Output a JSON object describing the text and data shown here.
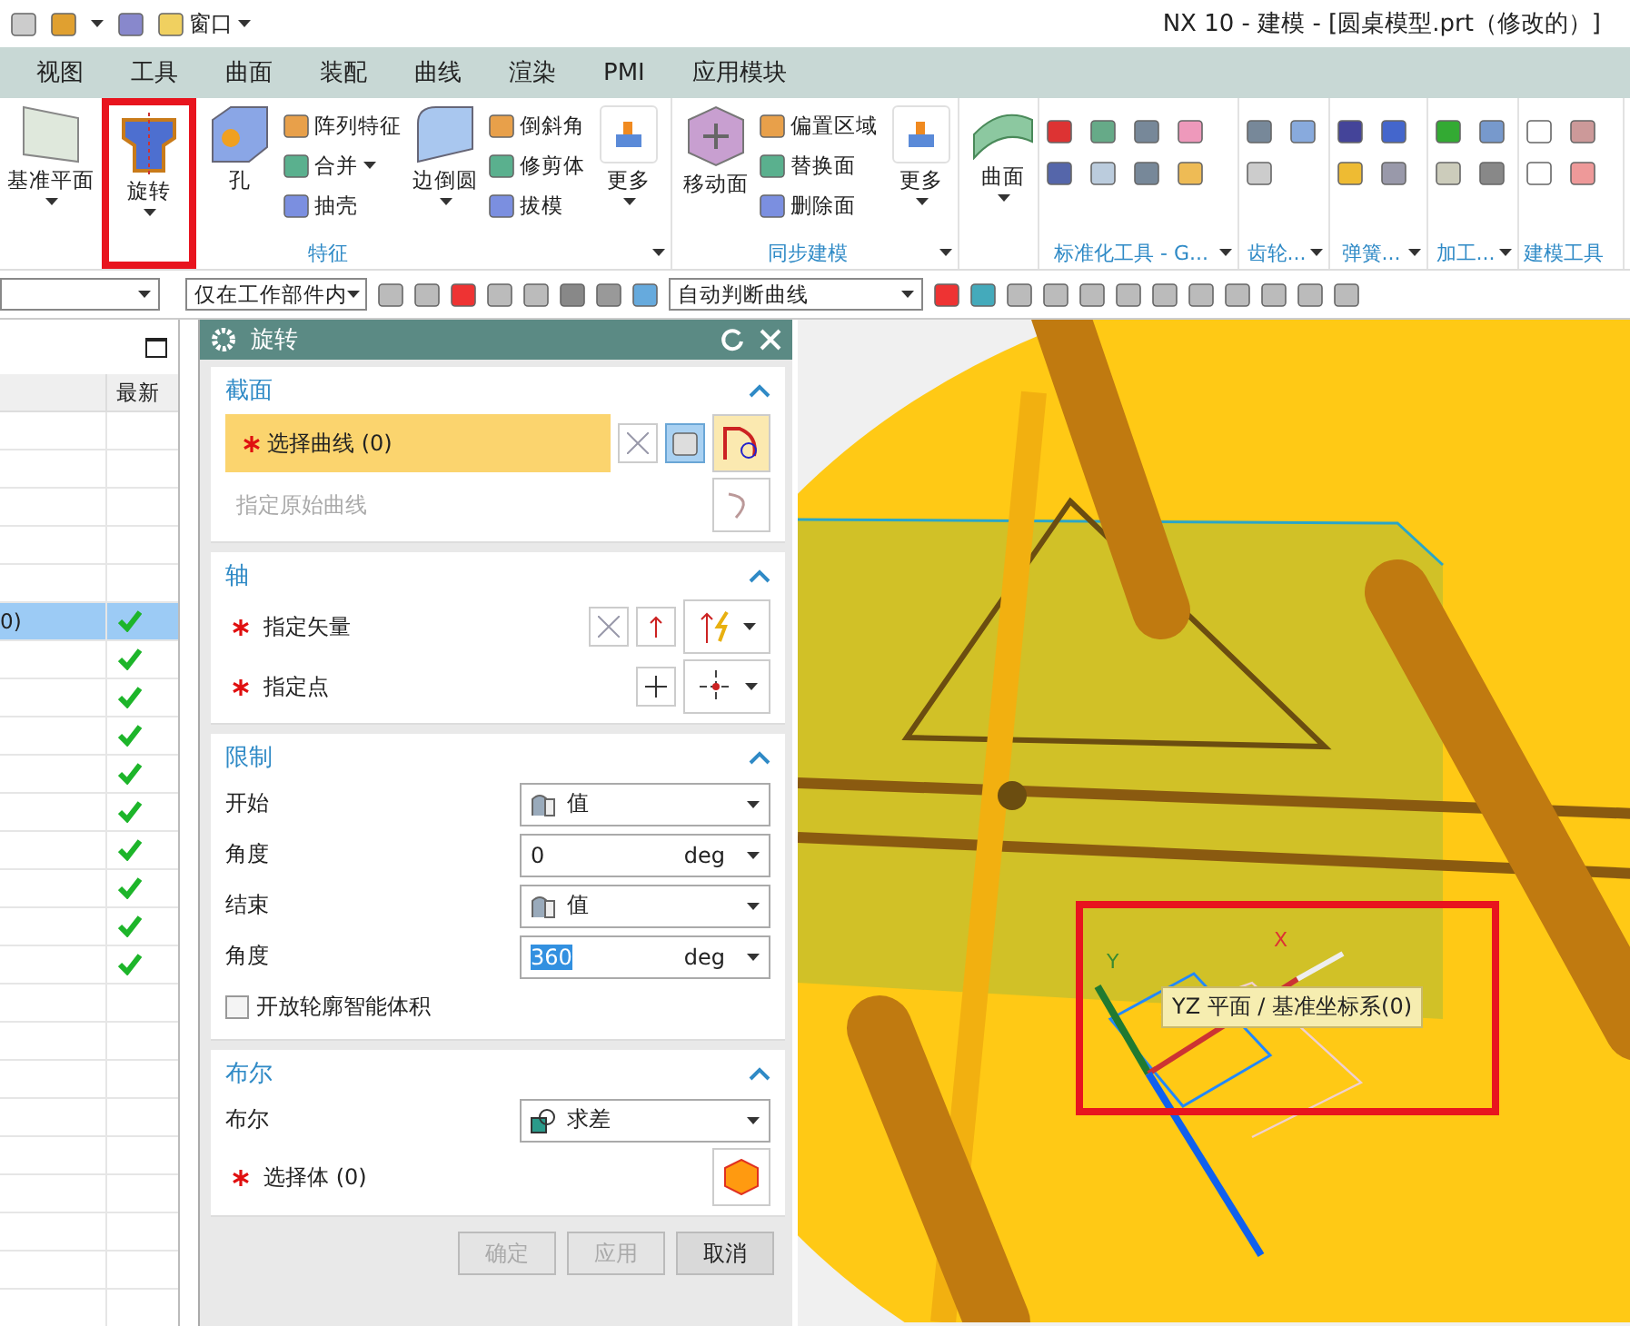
{
  "quick_access": {
    "window_menu": "窗口"
  },
  "title": "NX 10 - 建模 - [圆桌模型.prt（修改的）]",
  "menu_tabs": [
    "视图",
    "工具",
    "曲面",
    "装配",
    "曲线",
    "渲染",
    "PMI",
    "应用模块"
  ],
  "ribbon": {
    "groups": [
      {
        "label": "特征",
        "kind": "buttons",
        "launcher": true,
        "items": [
          {
            "kind": "large",
            "label": "基准平面",
            "caret": true
          },
          {
            "kind": "large",
            "label": "旋转",
            "caret": true
          },
          {
            "kind": "large",
            "label": "孔",
            "caret": false
          },
          {
            "kind": "stack",
            "items": [
              {
                "label": "阵列特征",
                "caret": false
              },
              {
                "label": "合并",
                "caret": true
              },
              {
                "label": "抽壳",
                "caret": false
              }
            ]
          },
          {
            "kind": "large",
            "label": "边倒圆",
            "caret": true
          },
          {
            "kind": "stack",
            "items": [
              {
                "label": "倒斜角",
                "caret": false
              },
              {
                "label": "修剪体",
                "caret": false
              },
              {
                "label": "拔模",
                "caret": false
              }
            ]
          },
          {
            "kind": "more",
            "label": "更多",
            "caret": true
          }
        ]
      },
      {
        "label": "同步建模",
        "kind": "buttons",
        "launcher": true,
        "items": [
          {
            "kind": "large",
            "label": "移动面",
            "caret": false
          },
          {
            "kind": "stack",
            "items": [
              {
                "label": "偏置区域",
                "caret": false
              },
              {
                "label": "替换面",
                "caret": false
              },
              {
                "label": "删除面",
                "caret": false
              }
            ]
          },
          {
            "kind": "more",
            "label": "更多",
            "caret": true
          }
        ]
      },
      {
        "kind": "buttons",
        "launcher": false,
        "items": [
          {
            "kind": "large",
            "label": "曲面",
            "caret": true
          }
        ]
      },
      {
        "label": "标准化工具 - G...",
        "kind": "icons",
        "launcher": true
      },
      {
        "label": "齿轮...",
        "kind": "icons",
        "launcher": true
      },
      {
        "label": "弹簧...",
        "kind": "icons",
        "launcher": true
      },
      {
        "label": "加工...",
        "kind": "icons",
        "launcher": true
      },
      {
        "label": "建模工具",
        "kind": "icons",
        "launcher": false
      }
    ]
  },
  "selection_bar": {
    "scope": "仅在工作部件内",
    "curve_rule": "自动判断曲线"
  },
  "navigator": {
    "column": "最新",
    "rows": [
      {
        "selected": false,
        "checked": false
      },
      {
        "selected": false,
        "checked": false
      },
      {
        "selected": false,
        "checked": false
      },
      {
        "selected": false,
        "checked": false
      },
      {
        "selected": false,
        "checked": false
      },
      {
        "text": "0)",
        "selected": true,
        "checked": true
      },
      {
        "selected": false,
        "checked": true
      },
      {
        "selected": false,
        "checked": true
      },
      {
        "selected": false,
        "checked": true
      },
      {
        "selected": false,
        "checked": true
      },
      {
        "selected": false,
        "checked": true
      },
      {
        "selected": false,
        "checked": true
      },
      {
        "selected": false,
        "checked": true
      },
      {
        "selected": false,
        "checked": true
      },
      {
        "selected": false,
        "checked": true
      },
      {
        "selected": false,
        "checked": false
      },
      {
        "selected": false,
        "checked": false
      },
      {
        "selected": false,
        "checked": false
      },
      {
        "selected": false,
        "checked": false
      },
      {
        "selected": false,
        "checked": false
      },
      {
        "selected": false,
        "checked": false
      },
      {
        "selected": false,
        "checked": false
      },
      {
        "selected": false,
        "checked": false
      },
      {
        "selected": false,
        "checked": false
      }
    ]
  },
  "dialog": {
    "title": "旋转",
    "sections": [
      {
        "title": "截面",
        "expanded": true,
        "rows": [
          {
            "kind": "select",
            "label": "选择曲线 (0)",
            "required": true,
            "active": true
          },
          {
            "kind": "hint",
            "label": "指定原始曲线",
            "disabled": true
          }
        ]
      },
      {
        "title": "轴",
        "expanded": true,
        "rows": [
          {
            "kind": "vector",
            "label": "指定矢量",
            "required": true
          },
          {
            "kind": "point",
            "label": "指定点",
            "required": true
          }
        ]
      },
      {
        "title": "限制",
        "expanded": true,
        "rows": [
          {
            "kind": "dropdown",
            "label": "开始",
            "value": "值"
          },
          {
            "kind": "number",
            "label": "角度",
            "value": "0",
            "unit": "deg",
            "highlighted": false
          },
          {
            "kind": "dropdown",
            "label": "结束",
            "value": "值"
          },
          {
            "kind": "number",
            "label": "角度",
            "value": "360",
            "unit": "deg",
            "highlighted": true
          },
          {
            "kind": "checkbox",
            "label": "开放轮廓智能体积",
            "checked": false
          }
        ]
      },
      {
        "title": "布尔",
        "expanded": true,
        "rows": [
          {
            "kind": "dropdown",
            "label": "布尔",
            "value": "求差"
          },
          {
            "kind": "body",
            "label": "选择体 (0)",
            "required": true
          }
        ]
      }
    ],
    "buttons": [
      {
        "label": "确定",
        "disabled": true
      },
      {
        "label": "应用",
        "disabled": true
      },
      {
        "label": "取消",
        "disabled": false
      }
    ]
  },
  "viewport": {
    "tooltip": "YZ 平面 / 基准坐标系(0)",
    "axis_labels": [
      "Y",
      "X"
    ]
  }
}
